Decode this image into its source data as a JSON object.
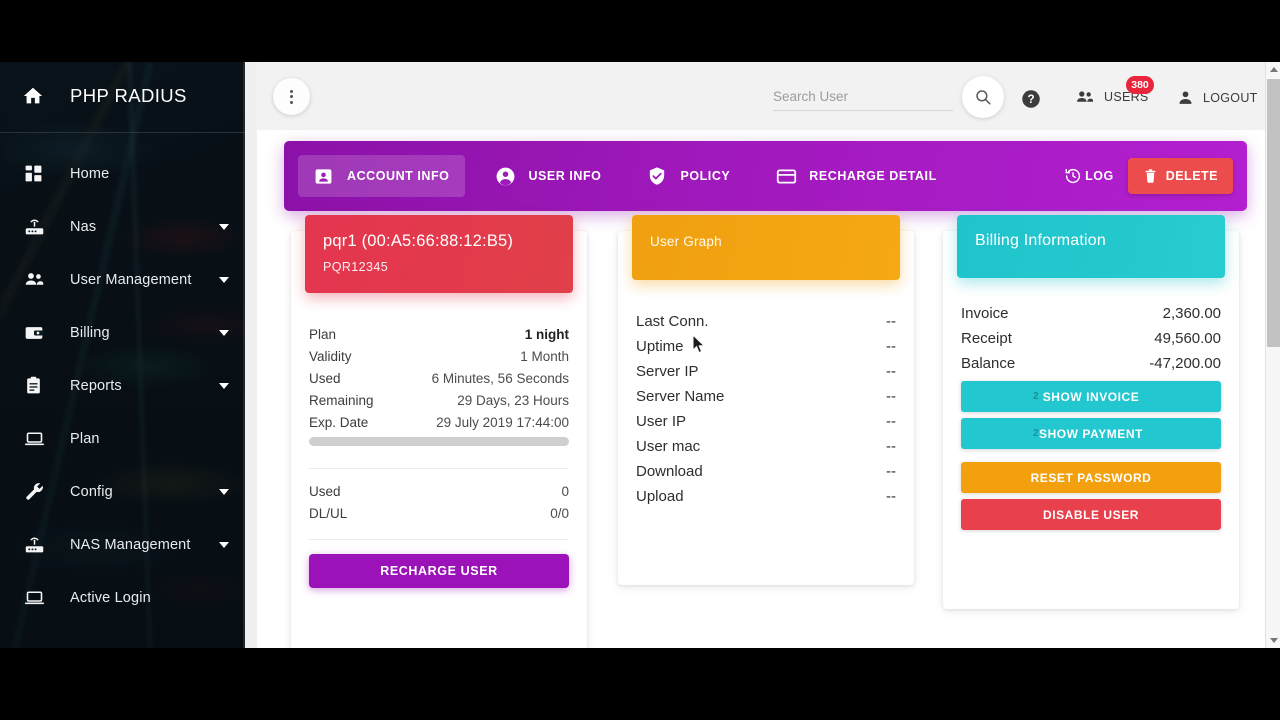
{
  "sidebar": {
    "brand": {
      "icon": "home-icon",
      "title": "PHP RADIUS"
    },
    "items": [
      {
        "label": "Home",
        "icon": "dashboard-icon",
        "caret": false
      },
      {
        "label": "Nas",
        "icon": "router-icon",
        "caret": true
      },
      {
        "label": "User Management",
        "icon": "users-icon",
        "caret": true
      },
      {
        "label": "Billing",
        "icon": "wallet-icon",
        "caret": true
      },
      {
        "label": "Reports",
        "icon": "clipboard-icon",
        "caret": true
      },
      {
        "label": "Plan",
        "icon": "laptop-icon",
        "caret": false
      },
      {
        "label": "Config",
        "icon": "wrench-icon",
        "caret": true
      },
      {
        "label": "NAS Management",
        "icon": "router-icon",
        "caret": true
      },
      {
        "label": "Active Login",
        "icon": "laptop-icon",
        "caret": false
      }
    ]
  },
  "header": {
    "menu_icon": "more-vertical-icon",
    "search": {
      "placeholder": "Search User",
      "value": ""
    },
    "search_icon": "search-icon",
    "help_icon": "help-circle-icon",
    "users_label": "USERS",
    "users_icon": "people-icon",
    "users_badge": "380",
    "logout_label": "LOGOUT",
    "logout_icon": "person-icon"
  },
  "tabbar": {
    "tabs": [
      {
        "label": "ACCOUNT INFO",
        "icon": "account-box-icon",
        "active": true
      },
      {
        "label": "USER INFO",
        "icon": "account-circle-icon",
        "active": false
      },
      {
        "label": "POLICY",
        "icon": "shield-check-icon",
        "active": false
      },
      {
        "label": "RECHARGE DETAIL",
        "icon": "credit-card-icon",
        "active": false
      }
    ],
    "log_label": "LOG",
    "log_icon": "history-icon",
    "delete_label": "DELETE",
    "delete_icon": "trash-icon",
    "accent": "#a019bc",
    "delete_color": "#ec4c4c"
  },
  "account_card": {
    "banner_color": "#e2374c",
    "title": "pqr1 (00:A5:66:88:12:B5)",
    "subtitle": "PQR12345",
    "rows": [
      {
        "key": "Plan",
        "value": "1 night",
        "strong": true
      },
      {
        "key": "Validity",
        "value": "1 Month",
        "strong": false
      },
      {
        "key": "Used",
        "value": "6 Minutes, 56 Seconds",
        "strong": false
      },
      {
        "key": "Remaining",
        "value": "29 Days, 23 Hours",
        "strong": false
      },
      {
        "key": "Exp. Date",
        "value": "29 July 2019 17:44:00",
        "strong": false
      }
    ],
    "usage_rows": [
      {
        "key": "Used",
        "value": "0"
      },
      {
        "key": "DL/UL",
        "value": "0/0"
      }
    ],
    "recharge_label": "RECHARGE USER",
    "recharge_color": "#9a12b8"
  },
  "graph_card": {
    "banner_color": "#f2a410",
    "title": "User Graph",
    "rows": [
      {
        "key": "Last Conn.",
        "value": "--"
      },
      {
        "key": "Uptime",
        "value": "--"
      },
      {
        "key": "Server IP",
        "value": "--"
      },
      {
        "key": "Server Name",
        "value": "--"
      },
      {
        "key": "User IP",
        "value": "--"
      },
      {
        "key": "User mac",
        "value": "--"
      },
      {
        "key": "Download",
        "value": "--"
      },
      {
        "key": "Upload",
        "value": "--"
      }
    ]
  },
  "billing_card": {
    "banner_color": "#23c8cd",
    "title": "Billing Information",
    "rows": [
      {
        "key": "Invoice",
        "value": "2,360.00"
      },
      {
        "key": "Receipt",
        "value": "49,560.00"
      },
      {
        "key": "Balance",
        "value": "-47,200.00"
      }
    ],
    "buttons": [
      {
        "label": "SHOW INVOICE",
        "badge": "2",
        "color": "teal"
      },
      {
        "label": "SHOW PAYMENT",
        "badge": "2",
        "color": "teal"
      },
      {
        "label": "RESET PASSWORD",
        "badge": "",
        "color": "orange"
      },
      {
        "label": "DISABLE USER",
        "badge": "",
        "color": "red"
      }
    ]
  }
}
